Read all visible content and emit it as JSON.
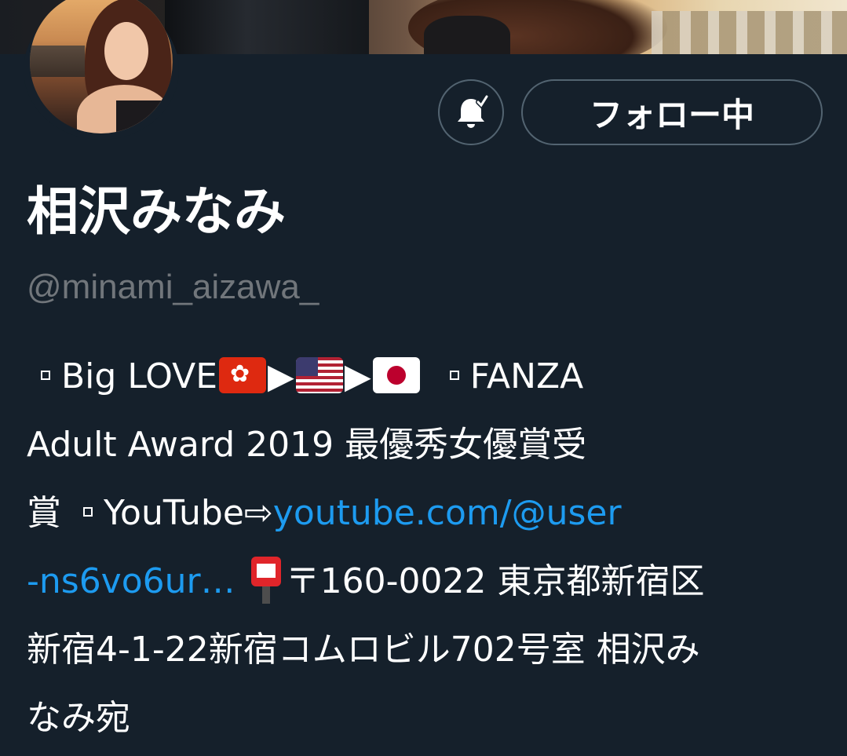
{
  "profile": {
    "display_name": "相沢みなみ",
    "handle": "@minami_aizawa_",
    "follow_label": "フォロー中",
    "bell_icon": "bell-check-icon"
  },
  "bio": {
    "line1_text": "Big LOVE",
    "line1_fanza": "FANZA",
    "line2": "Adult Award 2019 最優秀女優賞受",
    "line3_prefix": "賞",
    "line3_youtube": "YouTube⇨",
    "line3_link": "youtube.com/@user",
    "line4_link": "-ns6vo6ur…",
    "line4_address": "〒160-0022 東京都新宿区",
    "line5": "新宿4-1-22新宿コムロビル702号室 相沢み",
    "line6": "なみ宛",
    "flags": [
      "hong-kong-flag-icon",
      "united-states-flag-icon",
      "japan-flag-icon"
    ],
    "mailbox_icon": "postbox-icon",
    "arrow_glyph": "▶",
    "bullet_icon": "white-small-square-icon"
  },
  "colors": {
    "background": "#15202b",
    "link": "#1d9bf0",
    "handle": "#71767b",
    "button_border": "#536471"
  }
}
